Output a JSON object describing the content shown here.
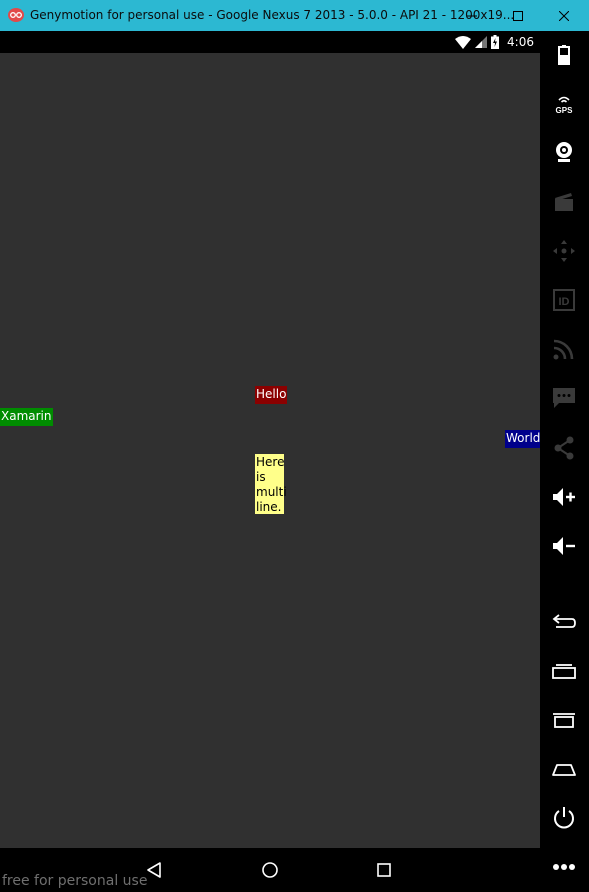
{
  "window": {
    "title": "Genymotion for personal use - Google Nexus 7 2013 - 5.0.0 - API 21 - 1200x19...",
    "titlebar_color": "#2cb8d2"
  },
  "statusbar": {
    "time": "4:06",
    "icons": [
      "wifi-icon",
      "signal-icon",
      "battery-charging-icon"
    ]
  },
  "screen": {
    "background": "#303030",
    "labels": {
      "hello": {
        "text": "Hello",
        "background": "#8b0000",
        "color": "#ffffff"
      },
      "xamarin": {
        "text": "Xamarin",
        "background": "#008c00",
        "color": "#ffffff"
      },
      "world": {
        "text": "World",
        "background": "#00008b",
        "color": "#ffffff"
      },
      "multiline": {
        "text": "Here\nis\nmulti\nline.",
        "background": "#ffff8a",
        "color": "#000000"
      }
    }
  },
  "navbar": {
    "buttons": [
      "back-icon",
      "home-icon",
      "recent-apps-icon"
    ],
    "watermark": "free for personal use"
  },
  "toolpanel": {
    "tools": [
      "battery-tool-icon",
      "gps-tool-icon",
      "webcam-tool-icon",
      "media-tool-icon",
      "dpad-tool-icon",
      "device-id-tool-icon",
      "cast-tool-icon",
      "sms-tool-icon",
      "share-tool-icon",
      "volume-up-tool-icon",
      "volume-down-tool-icon",
      "back-tool-icon",
      "recent-tool-icon",
      "menu-tool-icon",
      "home-tool-icon",
      "power-tool-icon",
      "more-tool-icon"
    ],
    "gps_label": "GPS",
    "id_label": "ID"
  }
}
